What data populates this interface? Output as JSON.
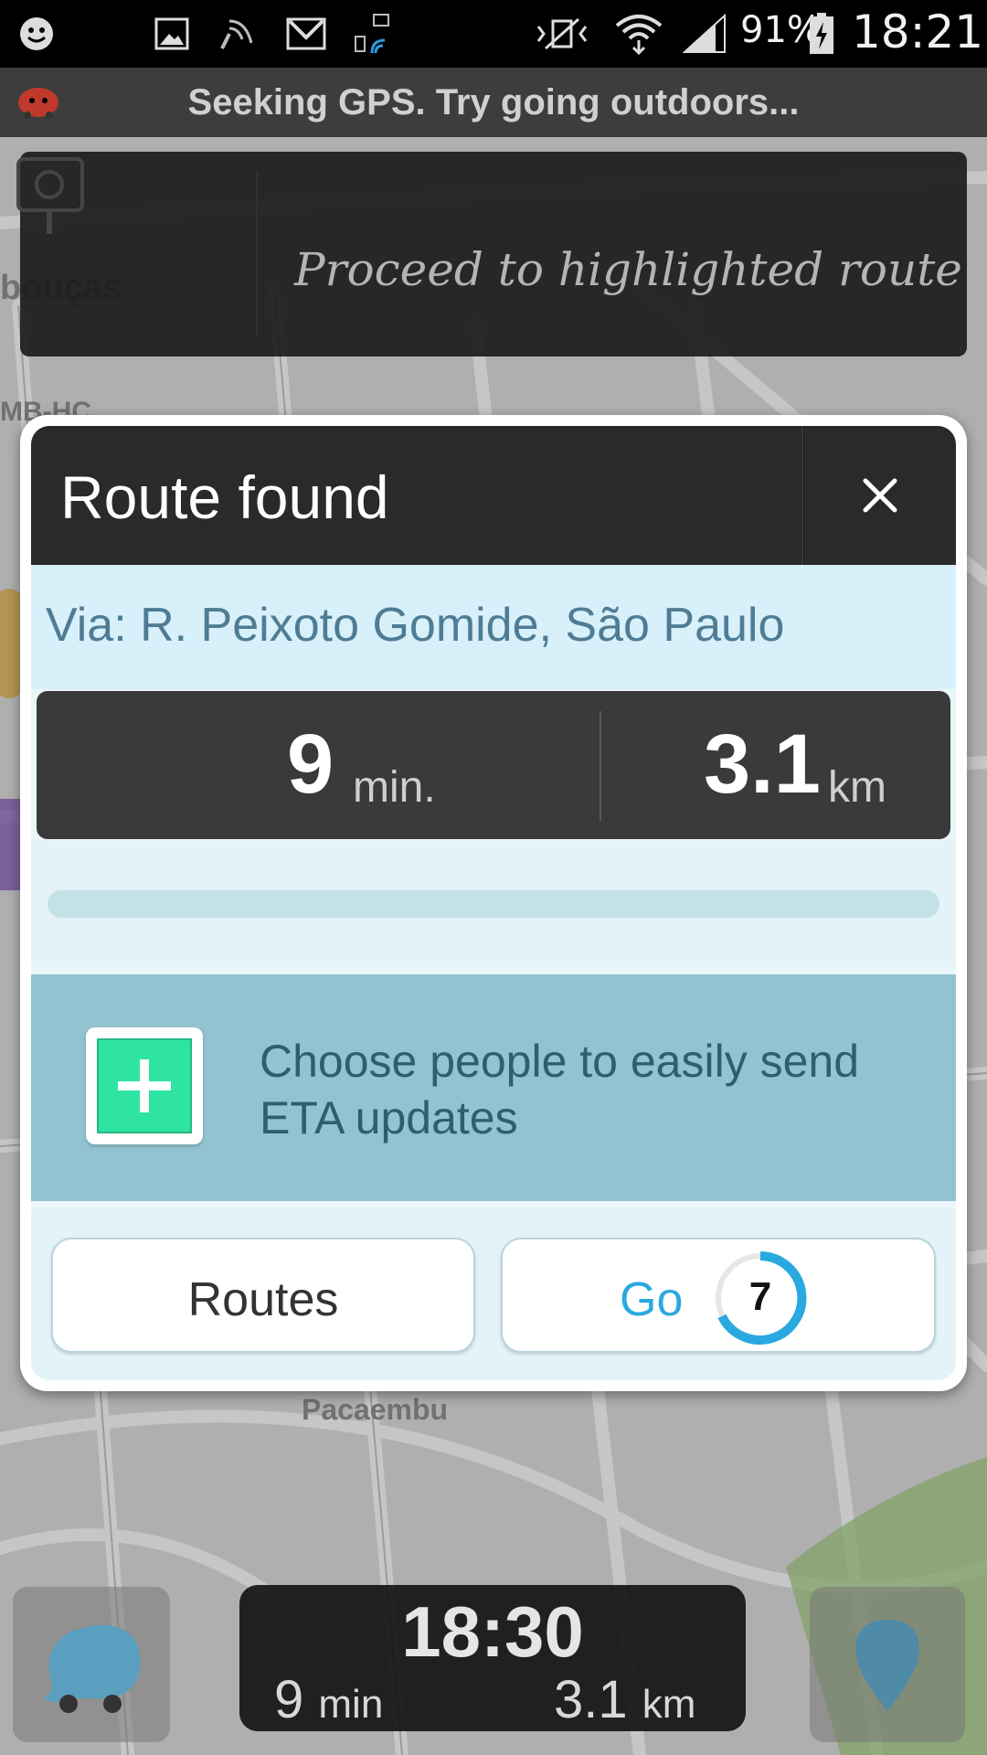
{
  "status_bar": {
    "battery": "91%",
    "time": "18:21",
    "icons": [
      "waze-smiley-icon",
      "image-icon",
      "broadcast-icon",
      "mail-icon",
      "network-icon",
      "vibrate-icon",
      "wifi-icon",
      "signal-icon",
      "battery-charging-icon"
    ]
  },
  "gps_banner": "Seeking GPS. Try going outdoors...",
  "instruction": "Proceed to highlighted route",
  "map_labels": {
    "pacaembu": "Pacaembu"
  },
  "dialog": {
    "title": "Route found",
    "via": "Via: R. Peixoto Gomide, São Paulo",
    "duration_value": "9",
    "duration_unit": "min.",
    "distance_value": "3.1",
    "distance_unit": "km",
    "eta_prompt": "Choose people to easily send ETA updates",
    "routes_label": "Routes",
    "go_label": "Go",
    "countdown": "7"
  },
  "bottom_bar": {
    "arrival_time": "18:30",
    "duration": "9",
    "duration_unit": "min",
    "distance": "3.1",
    "distance_unit": "km"
  },
  "colors": {
    "accent_blue": "#29a9e0",
    "plus_green": "#2fe4a2",
    "eta_panel": "#93c3d1",
    "via_text": "#4f7c95"
  }
}
